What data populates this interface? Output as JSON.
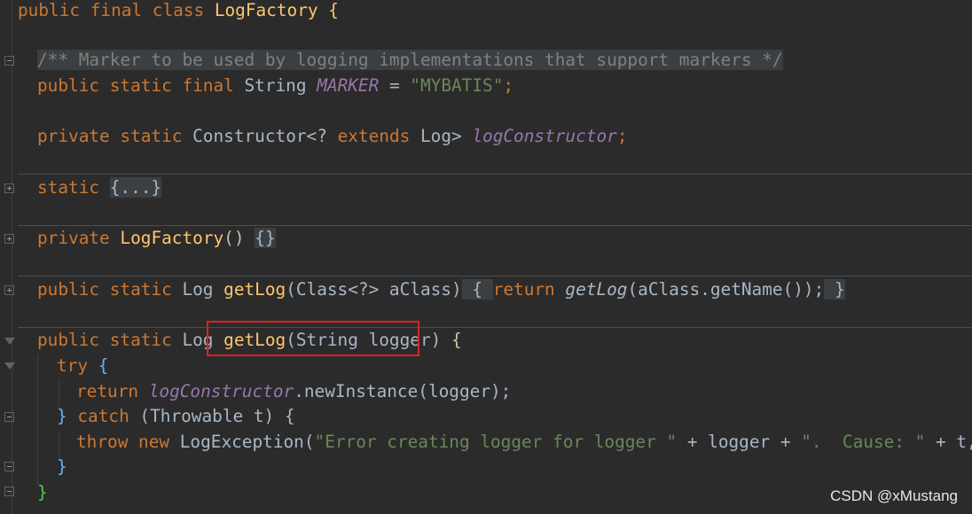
{
  "editor": {
    "lines": [
      {
        "k": "public final class",
        "fn": "LogFactory",
        "rest": " {"
      },
      {
        "comment": "/** Marker to be used by logging implementations that support markers */"
      },
      {
        "k": "public static final",
        "t": " String ",
        "f": "MARKER",
        "eq": " = ",
        "s": "\"MYBATIS\"",
        "end": ";"
      },
      {
        "k1": "private static",
        "t": " Constructor<? ",
        "k2": "extends",
        "t2": " Log> ",
        "f": "logConstructor",
        "end": ";"
      },
      {
        "k": "static",
        "fold": "{...}"
      },
      {
        "k": "private",
        "fn": "LogFactory",
        "p": "()",
        "fold": "{}"
      },
      {
        "k": "public static",
        "t": " Log ",
        "fn": "getLog",
        "p1": "(Class<?> aClass)",
        "o": " { ",
        "k2": "return",
        "call": "getLog",
        "args": "(aClass.getName());",
        "c": " }"
      },
      {
        "k": "public static",
        "t": " Log ",
        "fn": "getLog",
        "params": "(String logger)",
        "o": " {"
      },
      {
        "k": "try",
        "o": " {"
      },
      {
        "k": "return",
        "f": "logConstructor",
        "rest": ".newInstance(logger);"
      },
      {
        "c": "}",
        "k": "catch",
        "rest": " (Throwable t) {"
      },
      {
        "k": "throw new",
        "rest": " LogException(",
        "s": "\"Error creating logger for logger \"",
        "rest2": " + logger + ",
        "s2": "\".  Cause: \"",
        "rest3": " + t, t);"
      },
      {
        "c": "}"
      },
      {
        "c": "}"
      }
    ]
  },
  "watermark": "CSDN @xMustang"
}
